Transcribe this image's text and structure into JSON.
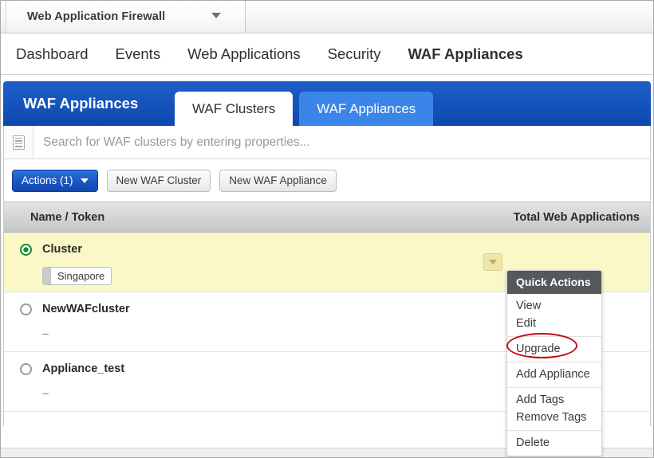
{
  "window": {
    "app_title": "Web Application Firewall",
    "app_menu_caret_icon": "chevron-down-icon"
  },
  "primary_nav": {
    "items": [
      {
        "label": "Dashboard",
        "active": false
      },
      {
        "label": "Events",
        "active": false
      },
      {
        "label": "Web Applications",
        "active": false
      },
      {
        "label": "Security",
        "active": false
      },
      {
        "label": "WAF Appliances",
        "active": true
      }
    ]
  },
  "section": {
    "title": "WAF Appliances",
    "banner_color": "#1756bf",
    "tabs": [
      {
        "label": "WAF Clusters",
        "active": true
      },
      {
        "label": "WAF Appliances",
        "active": false
      }
    ]
  },
  "search": {
    "icon": "document-list-icon",
    "placeholder": "Search for WAF clusters by entering properties...",
    "value": ""
  },
  "toolbar": {
    "actions_label": "Actions (1)",
    "actions_caret_icon": "chevron-down-icon",
    "actions_color": "#1b57c2",
    "buttons": [
      {
        "label": "New WAF Cluster"
      },
      {
        "label": "New WAF Appliance"
      }
    ]
  },
  "table": {
    "columns": {
      "name": "Name / Token",
      "total": "Total Web Applications"
    },
    "rows": [
      {
        "name": "Cluster",
        "selected": true,
        "radio_state": "checked",
        "radio_color": "#148a2a",
        "tag": "Singapore",
        "token": "",
        "chevron_icon": "chevron-down-icon"
      },
      {
        "name": "NewWAFcluster",
        "selected": false,
        "radio_state": "unchecked",
        "tag": "",
        "token": "–"
      },
      {
        "name": "Appliance_test",
        "selected": false,
        "radio_state": "unchecked",
        "tag": "",
        "token": "–"
      }
    ]
  },
  "quick_actions": {
    "title": "Quick Actions",
    "header_color": "#55585c",
    "groups": [
      {
        "items": [
          {
            "label": "View"
          },
          {
            "label": "Edit"
          }
        ]
      },
      {
        "items": [
          {
            "label": "Upgrade",
            "annotated": true
          }
        ]
      },
      {
        "items": [
          {
            "label": "Add Appliance"
          }
        ]
      },
      {
        "items": [
          {
            "label": "Add Tags"
          },
          {
            "label": "Remove Tags"
          }
        ]
      },
      {
        "items": [
          {
            "label": "Delete"
          }
        ]
      }
    ],
    "annotation_color": "#c00d10"
  }
}
